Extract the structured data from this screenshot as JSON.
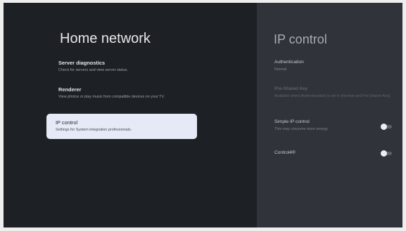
{
  "home_network": {
    "title": "Home network",
    "items": [
      {
        "title": "Server diagnostics",
        "subtitle": "Check for servers and view server status."
      },
      {
        "title": "Renderer",
        "subtitle": "View photos or play music from compatible devices on your TV."
      },
      {
        "title": "IP control",
        "subtitle": "Settings for System integration professionals."
      }
    ]
  },
  "ip_control": {
    "title": "IP control",
    "authentication": {
      "label": "Authentication",
      "value": "Normal"
    },
    "pre_shared_key": {
      "label": "Pre-Shared Key",
      "value": "Available when [Authentication] is set to [Normal and Pre-Shared Key]."
    },
    "simple_ip_control": {
      "label": "Simple IP control",
      "value": "This may consume more energy.",
      "enabled": false
    },
    "control4": {
      "label": "Control4®",
      "enabled": false
    }
  }
}
